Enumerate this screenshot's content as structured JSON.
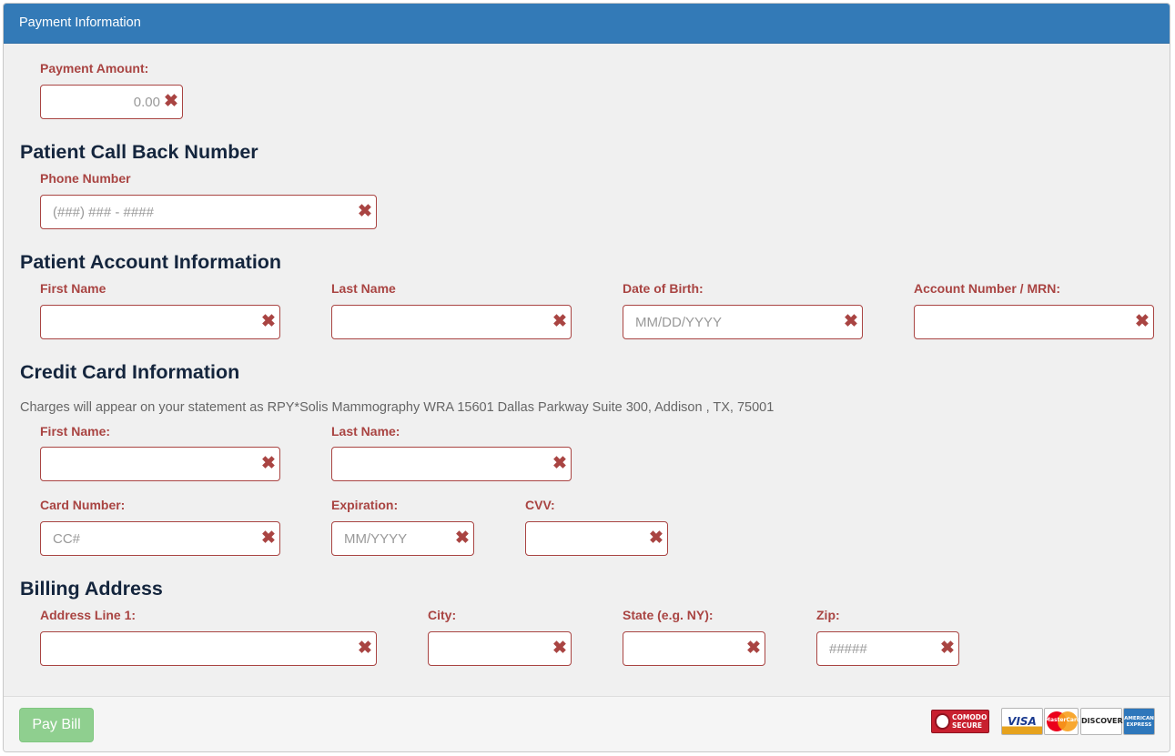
{
  "panel": {
    "title": "Payment Information"
  },
  "payment": {
    "amount_label": "Payment Amount:",
    "amount_value": "0.00"
  },
  "callback": {
    "heading": "Patient Call Back Number",
    "phone_label": "Phone Number",
    "phone_placeholder": "(###) ### - ####"
  },
  "account": {
    "heading": "Patient Account Information",
    "first_name_label": "First Name",
    "last_name_label": "Last Name",
    "dob_label": "Date of Birth:",
    "dob_placeholder": "MM/DD/YYYY",
    "mrn_label": "Account Number / MRN:"
  },
  "credit_card": {
    "heading": "Credit Card Information",
    "statement_note": "Charges will appear on your statement as RPY*Solis Mammography WRA 15601 Dallas Parkway Suite 300, Addison , TX, 75001",
    "first_name_label": "First Name:",
    "last_name_label": "Last Name:",
    "card_number_label": "Card Number:",
    "card_number_placeholder": "CC#",
    "expiration_label": "Expiration:",
    "expiration_placeholder": "MM/YYYY",
    "cvv_label": "CVV:"
  },
  "billing": {
    "heading": "Billing Address",
    "address1_label": "Address Line 1:",
    "city_label": "City:",
    "state_label": "State (e.g. NY):",
    "zip_label": "Zip:",
    "zip_placeholder": "#####"
  },
  "footer": {
    "pay_button": "Pay Bill",
    "secure_badge": {
      "line1": "COMODO",
      "line2": "SECURE"
    },
    "cards": {
      "visa": "VISA",
      "mastercard": "MasterCard",
      "discover": "DISCOVER",
      "amex": "AMERICAN EXPRESS"
    }
  },
  "icons": {
    "clear": "✖"
  },
  "colors": {
    "header_bg": "#337ab7",
    "label_error": "#a94442",
    "heading": "#14253d",
    "pay_button_bg": "#8fcf8f"
  }
}
